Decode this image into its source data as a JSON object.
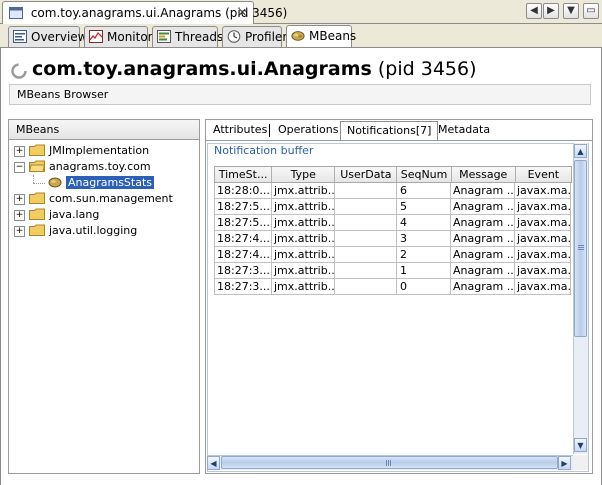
{
  "window": {
    "doc_tab_title": "com.toy.anagrams.ui.Anagrams (pid 3456)",
    "doc_tab_close": "✕",
    "nav_left": "◀",
    "nav_right": "▶",
    "menu_down": "▼",
    "restore": "▭"
  },
  "tabs": [
    {
      "label": "Overview",
      "icon": "overview-icon"
    },
    {
      "label": "Monitor",
      "icon": "monitor-icon"
    },
    {
      "label": "Threads",
      "icon": "threads-icon"
    },
    {
      "label": "Profiler",
      "icon": "profiler-icon"
    },
    {
      "label": "MBeans",
      "icon": "mbeans-icon",
      "selected": true
    }
  ],
  "header": {
    "app_title": "com.toy.anagrams.ui.Anagrams",
    "pid": "(pid 3456)",
    "section_label": "MBeans Browser"
  },
  "tree": {
    "header": "MBeans",
    "nodes": [
      {
        "label": "JMImplementation",
        "expander": "+",
        "indent": 0
      },
      {
        "label": "anagrams.toy.com",
        "expander": "−",
        "indent": 0
      },
      {
        "label": "AnagramsStats",
        "expander": "",
        "indent": 1,
        "selected": true
      },
      {
        "label": "com.sun.management",
        "expander": "+",
        "indent": 0
      },
      {
        "label": "java.lang",
        "expander": "+",
        "indent": 0
      },
      {
        "label": "java.util.logging",
        "expander": "+",
        "indent": 0
      }
    ]
  },
  "subtabs": [
    {
      "label": "Attributes"
    },
    {
      "label": "Operations"
    },
    {
      "label": "Notifications[7]",
      "selected": true
    },
    {
      "label": "Metadata"
    }
  ],
  "notifications": {
    "group_title": "Notification buffer",
    "columns": [
      "TimeSt...",
      "Type",
      "UserData",
      "SeqNum",
      "Message",
      "Event"
    ],
    "rows": [
      [
        "18:28:0...",
        "jmx.attrib...",
        "",
        "6",
        "Anagram ...",
        "javax.ma..."
      ],
      [
        "18:27:5...",
        "jmx.attrib...",
        "",
        "5",
        "Anagram ...",
        "javax.ma..."
      ],
      [
        "18:27:5...",
        "jmx.attrib...",
        "",
        "4",
        "Anagram ...",
        "javax.ma..."
      ],
      [
        "18:27:4...",
        "jmx.attrib...",
        "",
        "3",
        "Anagram ...",
        "javax.ma..."
      ],
      [
        "18:27:4...",
        "jmx.attrib...",
        "",
        "2",
        "Anagram ...",
        "javax.ma..."
      ],
      [
        "18:27:3...",
        "jmx.attrib...",
        "",
        "1",
        "Anagram ...",
        "javax.ma..."
      ],
      [
        "18:27:3...",
        "jmx.attrib...",
        "",
        "0",
        "Anagram ...",
        "javax.ma..."
      ]
    ]
  },
  "scroll": {
    "up": "▲",
    "down": "▼",
    "left": "◀",
    "right": "▶"
  },
  "colors": {
    "accent": "#2b5fb8",
    "group_title": "#2d5ea8",
    "folder": "#e8c25a"
  }
}
